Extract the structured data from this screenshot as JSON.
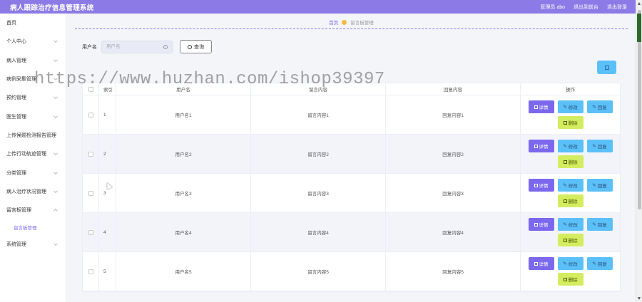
{
  "app": {
    "title": "病人跟踪治疗信息管理系统"
  },
  "header": {
    "links": [
      "管理员 abo",
      "退出到前台",
      "退出登录"
    ]
  },
  "sidebar": {
    "items": [
      {
        "label": "首页",
        "chevron": false
      },
      {
        "label": "个人中心",
        "chevron": true
      },
      {
        "label": "病人管理",
        "chevron": true
      },
      {
        "label": "病例采集管理",
        "chevron": true
      },
      {
        "label": "预约管理",
        "chevron": true
      },
      {
        "label": "医生管理",
        "chevron": true
      },
      {
        "label": "上传候题检测报告管理",
        "chevron": false
      },
      {
        "label": "上传行动轨迹管理",
        "chevron": true
      },
      {
        "label": "分类管理",
        "chevron": true
      },
      {
        "label": "病人治疗状况管理",
        "chevron": true
      },
      {
        "label": "留言板管理",
        "chevron": true,
        "open": true
      },
      {
        "label": "系统管理",
        "chevron": true
      }
    ],
    "sub_item": "留言板管理"
  },
  "breadcrumb": {
    "home": "首页",
    "current": "留言板管理"
  },
  "search": {
    "label": "用户名",
    "placeholder": "用户名",
    "button": "查询"
  },
  "add_icon": "plus-square-icon",
  "table": {
    "headers": [
      "索引",
      "用户名",
      "留言内容",
      "回复内容",
      "操作"
    ],
    "rows": [
      {
        "index": "1",
        "user": "用户名1",
        "msg": "留言内容1",
        "reply": "回复内容1"
      },
      {
        "index": "2",
        "user": "用户名2",
        "msg": "留言内容2",
        "reply": "回复内容2"
      },
      {
        "index": "3",
        "user": "用户名3",
        "msg": "留言内容3",
        "reply": "回复内容3"
      },
      {
        "index": "4",
        "user": "用户名4",
        "msg": "留言内容4",
        "reply": "回复内容4"
      },
      {
        "index": "5",
        "user": "用户名5",
        "msg": "留言内容5",
        "reply": "回复内容5"
      }
    ],
    "actions": {
      "detail": "详情",
      "edit": "修改",
      "reply": "回复",
      "delete": "删除"
    }
  },
  "watermark": "https://www.huzhan.com/ishop39397",
  "colors": {
    "accent": "#8c7ae6",
    "detail": "#7b68ee",
    "info": "#5bc0f8",
    "delete": "#d4ed60"
  }
}
